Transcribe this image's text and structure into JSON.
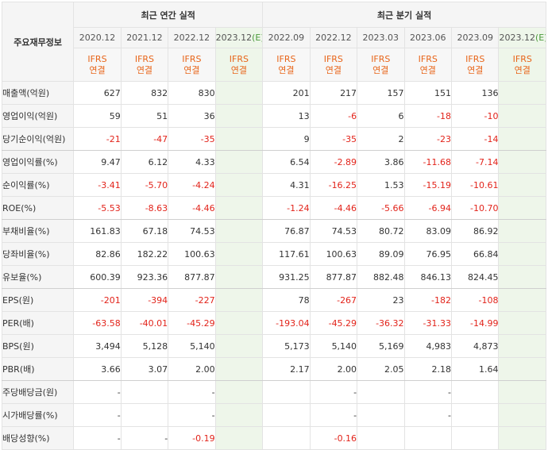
{
  "header": {
    "row_label": "주요재무정보",
    "annual_group": "최근 연간 실적",
    "quarter_group": "최근 분기 실적",
    "annual_periods": [
      "2020.12",
      "2021.12",
      "2022.12",
      "2023.12"
    ],
    "annual_est_mark": "(E)",
    "quarter_periods": [
      "2022.09",
      "2022.12",
      "2023.03",
      "2023.06",
      "2023.09",
      "2023.12"
    ],
    "quarter_est_mark": "(E)",
    "basis_top": "IFRS",
    "basis_bottom": "연결"
  },
  "rows": [
    {
      "label": "매출액(억원)",
      "annual": [
        "627",
        "832",
        "830",
        ""
      ],
      "quarter": [
        "201",
        "217",
        "157",
        "151",
        "136",
        ""
      ]
    },
    {
      "label": "영업이익(억원)",
      "annual": [
        "59",
        "51",
        "36",
        ""
      ],
      "quarter": [
        "13",
        "-6",
        "6",
        "-18",
        "-10",
        ""
      ]
    },
    {
      "label": "당기순이익(억원)",
      "annual": [
        "-21",
        "-47",
        "-35",
        ""
      ],
      "quarter": [
        "9",
        "-35",
        "2",
        "-23",
        "-14",
        ""
      ]
    },
    {
      "label": "영업이익률(%)",
      "annual": [
        "9.47",
        "6.12",
        "4.33",
        ""
      ],
      "quarter": [
        "6.54",
        "-2.89",
        "3.86",
        "-11.68",
        "-7.14",
        ""
      ]
    },
    {
      "label": "순이익률(%)",
      "annual": [
        "-3.41",
        "-5.70",
        "-4.24",
        ""
      ],
      "quarter": [
        "4.31",
        "-16.25",
        "1.53",
        "-15.19",
        "-10.61",
        ""
      ]
    },
    {
      "label": "ROE(%)",
      "annual": [
        "-5.53",
        "-8.63",
        "-4.46",
        ""
      ],
      "quarter": [
        "-1.24",
        "-4.46",
        "-5.66",
        "-6.94",
        "-10.70",
        ""
      ]
    },
    {
      "label": "부채비율(%)",
      "annual": [
        "161.83",
        "67.18",
        "74.53",
        ""
      ],
      "quarter": [
        "76.87",
        "74.53",
        "80.72",
        "83.09",
        "86.92",
        ""
      ]
    },
    {
      "label": "당좌비율(%)",
      "annual": [
        "82.86",
        "182.22",
        "100.63",
        ""
      ],
      "quarter": [
        "117.61",
        "100.63",
        "89.09",
        "76.95",
        "66.84",
        ""
      ]
    },
    {
      "label": "유보율(%)",
      "annual": [
        "600.39",
        "923.36",
        "877.87",
        ""
      ],
      "quarter": [
        "931.25",
        "877.87",
        "882.48",
        "846.13",
        "824.45",
        ""
      ]
    },
    {
      "label": "EPS(원)",
      "annual": [
        "-201",
        "-394",
        "-227",
        ""
      ],
      "quarter": [
        "78",
        "-267",
        "23",
        "-182",
        "-108",
        ""
      ]
    },
    {
      "label": "PER(배)",
      "annual": [
        "-63.58",
        "-40.01",
        "-45.29",
        ""
      ],
      "quarter": [
        "-193.04",
        "-45.29",
        "-36.32",
        "-31.33",
        "-14.99",
        ""
      ]
    },
    {
      "label": "BPS(원)",
      "annual": [
        "3,494",
        "5,128",
        "5,140",
        ""
      ],
      "quarter": [
        "5,173",
        "5,140",
        "5,169",
        "4,983",
        "4,873",
        ""
      ]
    },
    {
      "label": "PBR(배)",
      "annual": [
        "3.66",
        "3.07",
        "2.00",
        ""
      ],
      "quarter": [
        "2.17",
        "2.00",
        "2.05",
        "2.18",
        "1.64",
        ""
      ]
    },
    {
      "label": "주당배당금(원)",
      "annual": [
        "-",
        "",
        "-",
        ""
      ],
      "quarter": [
        "",
        "-",
        "",
        "-",
        "",
        ""
      ]
    },
    {
      "label": "시가배당률(%)",
      "annual": [
        "-",
        "",
        "-",
        ""
      ],
      "quarter": [
        "",
        "-",
        "",
        "-",
        "",
        ""
      ]
    },
    {
      "label": "배당성향(%)",
      "annual": [
        "-",
        "-",
        "-0.19",
        ""
      ],
      "quarter": [
        "",
        "-0.16",
        "",
        "",
        "",
        ""
      ]
    }
  ],
  "colors": {
    "negative": "#e2231a",
    "basis_text": "#e8651a",
    "estimate_bg": "#eef6ea",
    "estimate_mark": "#4a9a3a",
    "header_bg": "#f5f5f5"
  }
}
